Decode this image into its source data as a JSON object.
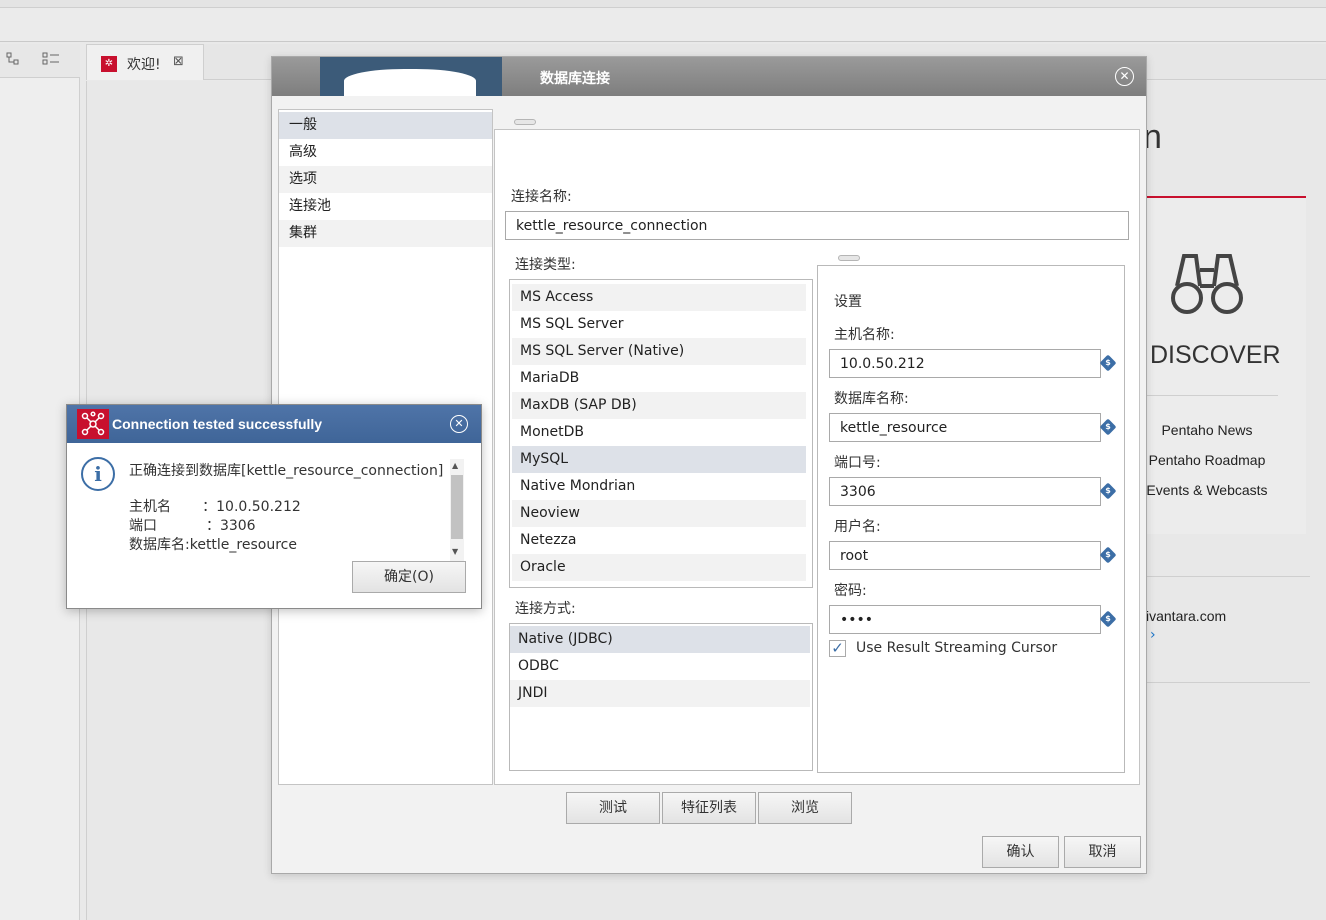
{
  "welcome_tab": {
    "label": "欢迎!",
    "close": "⊠"
  },
  "welcome_page": {
    "partial_title": "n",
    "discover_title": "DISCOVER",
    "links": [
      "Pentaho News",
      "Pentaho Roadmap",
      "Events & Webcasts"
    ],
    "hitachi_partial": "ivantara.com",
    "chevron": "›"
  },
  "db_dialog": {
    "title": "数据库连接",
    "close": "✕",
    "categories": [
      {
        "label": "一般",
        "selected": true
      },
      {
        "label": "高级"
      },
      {
        "label": "选项"
      },
      {
        "label": "连接池"
      },
      {
        "label": "集群"
      }
    ],
    "connection_name_label": "连接名称:",
    "connection_name_value": "kettle_resource_connection",
    "connection_type_label": "连接类型:",
    "connection_types": [
      "MS Access",
      "MS SQL Server",
      "MS SQL Server (Native)",
      "MariaDB",
      "MaxDB (SAP DB)",
      "MonetDB",
      "MySQL",
      "Native Mondrian",
      "Neoview",
      "Netezza",
      "Oracle"
    ],
    "selected_type": "MySQL",
    "access_label": "连接方式:",
    "access_methods": [
      "Native (JDBC)",
      "ODBC",
      "JNDI"
    ],
    "selected_access": "Native (JDBC)",
    "settings": {
      "title": "设置",
      "host_label": "主机名称:",
      "host_value": "10.0.50.212",
      "dbname_label": "数据库名称:",
      "dbname_value": "kettle_resource",
      "port_label": "端口号:",
      "port_value": "3306",
      "user_label": "用户名:",
      "user_value": "root",
      "password_label": "密码:",
      "password_value": "••••",
      "streaming_label": "Use Result Streaming Cursor",
      "streaming_checked": true
    },
    "buttons": {
      "test": "测试",
      "features": "特征列表",
      "explore": "浏览",
      "ok": "确认",
      "cancel": "取消"
    }
  },
  "msg_dialog": {
    "title": "Connection tested successfully",
    "close": "✕",
    "line1": "正确连接到数据库[kettle_resource_connection]",
    "line2": "主机名       ：10.0.50.212",
    "line3": "端口           ：3306",
    "line4": "数据库名:kettle_resource",
    "ok_button": "确定(O)"
  }
}
